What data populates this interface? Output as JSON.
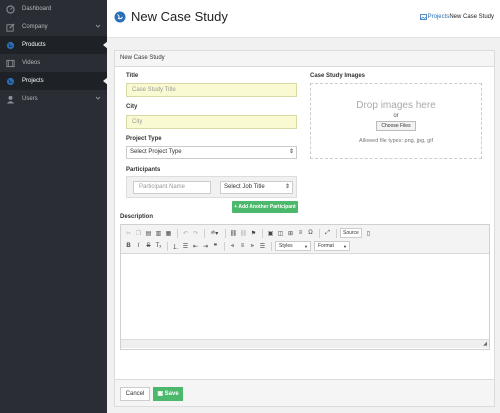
{
  "sidebar": {
    "items": [
      {
        "label": "Dashboard",
        "icon": "dashboard-icon"
      },
      {
        "label": "Company",
        "icon": "edit-icon"
      },
      {
        "label": "Products",
        "icon": "globe-icon"
      },
      {
        "label": "Videos",
        "icon": "film-icon"
      },
      {
        "label": "Projects",
        "icon": "globe-icon"
      },
      {
        "label": "Users",
        "icon": "user-icon"
      }
    ],
    "active_items": [
      "Products",
      "Projects"
    ]
  },
  "header": {
    "title": "New Case Study",
    "breadcrumb": {
      "link": "Projects",
      "current": "New Case Study"
    }
  },
  "panel": {
    "heading": "New Case Study",
    "title_label": "Title",
    "title_placeholder": "Case Study Title",
    "city_label": "City",
    "city_placeholder": "City",
    "project_type_label": "Project Type",
    "project_type_value": "Select Project Type",
    "participants_label": "Participants",
    "participant_name_placeholder": "Participant Name",
    "job_title_value": "Select Job Title",
    "add_participant": "+ Add Another Participant",
    "images_label": "Case Study Images",
    "dropzone_title": "Drop images here",
    "dropzone_or": "or",
    "choose_files": "Choose Files",
    "allowed_types": "Allowed file types: png, jpg, gif",
    "description_label": "Description",
    "editor": {
      "source": "Source",
      "styles": "Styles",
      "format": "Format"
    },
    "cancel": "Cancel",
    "save": "Save"
  },
  "colors": {
    "sidebar_bg": "#2a2d33",
    "accent_blue": "#2a6fb8",
    "success_green": "#4cb86c",
    "input_highlight": "#fafad2"
  }
}
